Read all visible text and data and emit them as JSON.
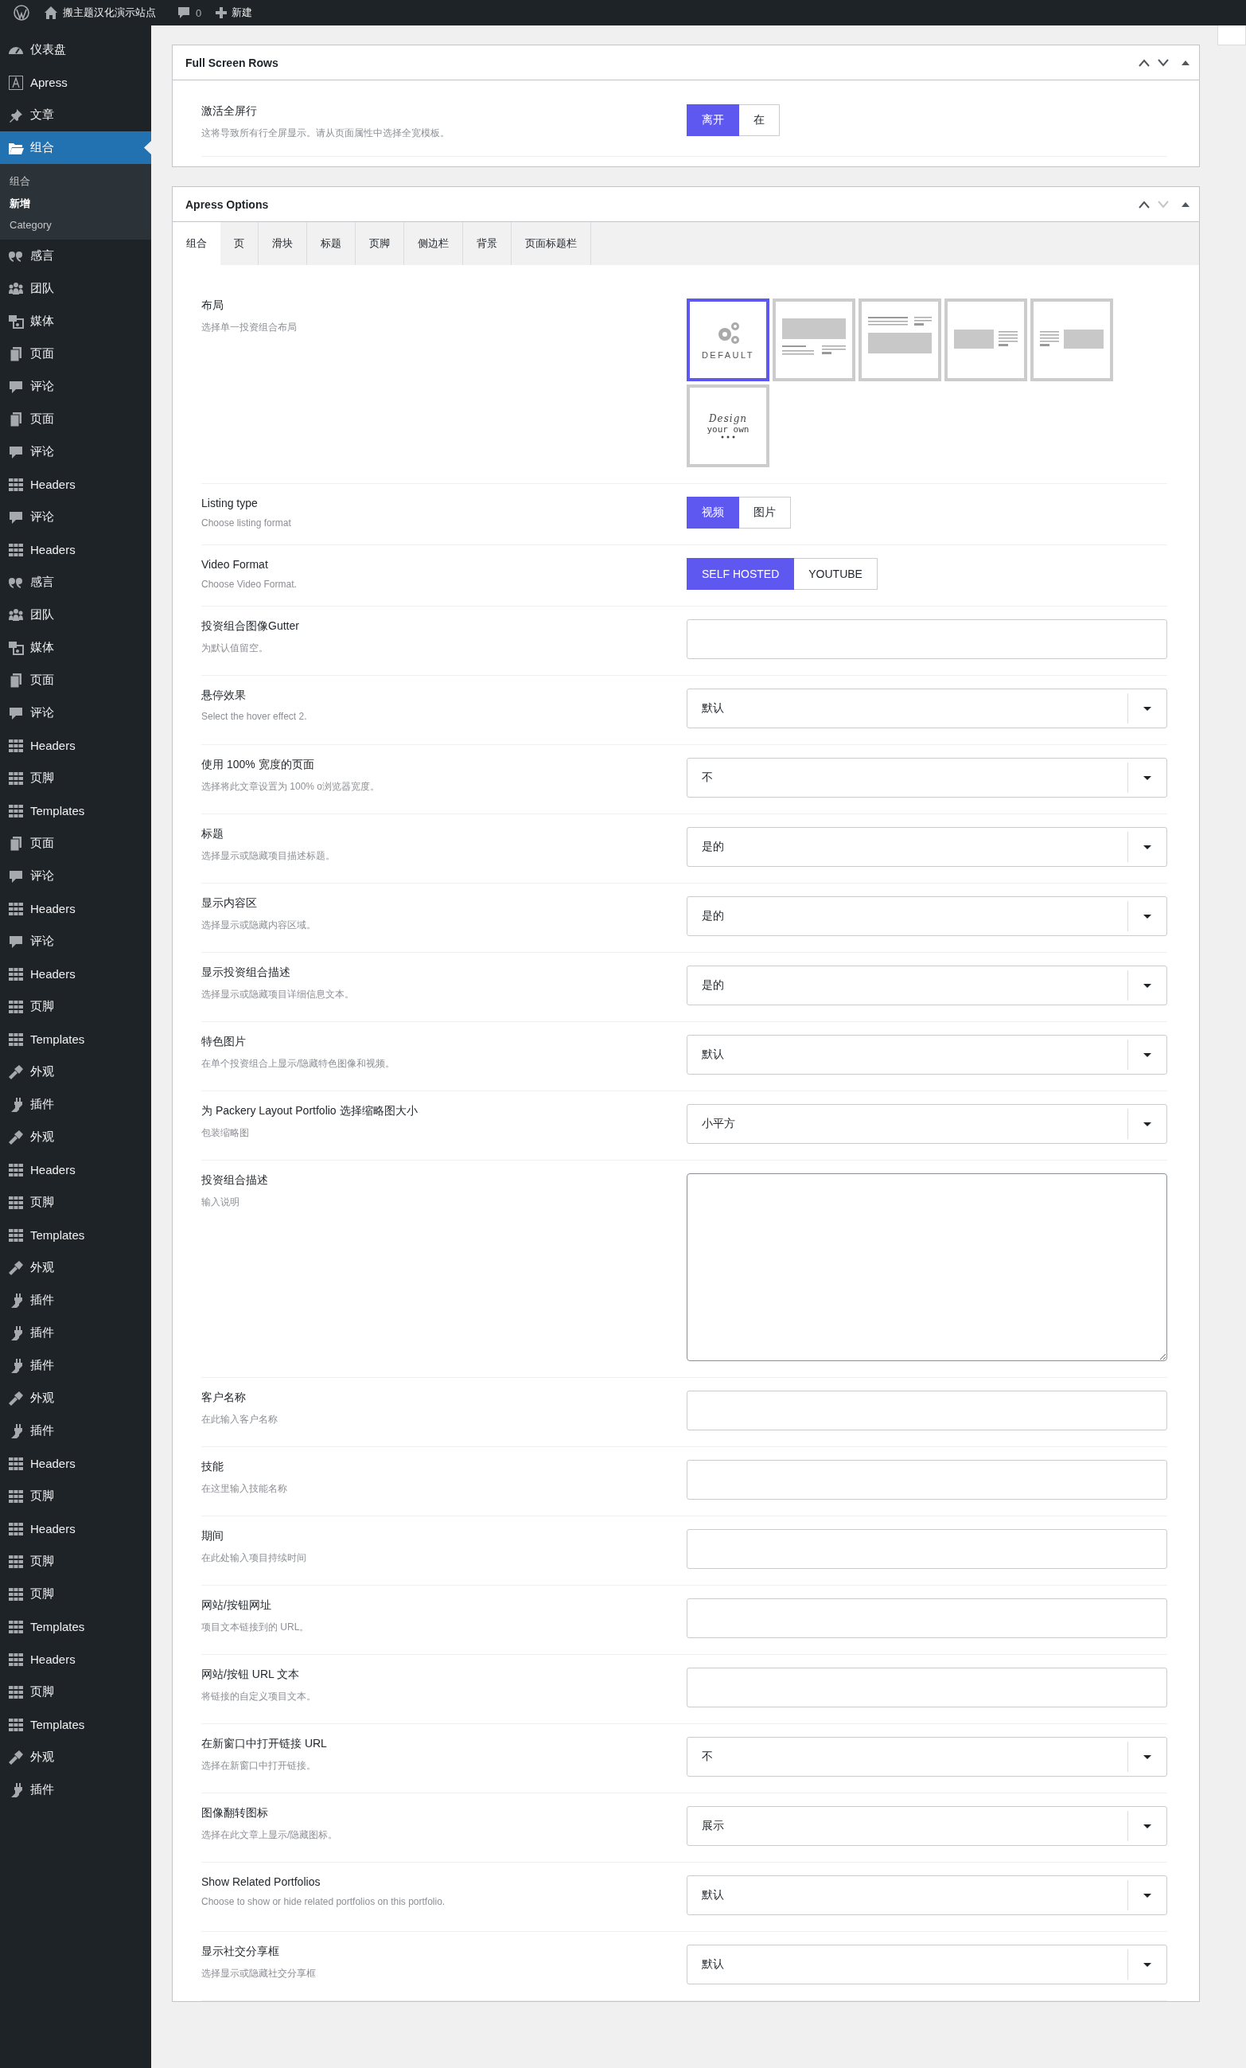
{
  "admin_bar": {
    "site_name": "搬主题汉化演示站点",
    "comments": "0",
    "new": "新建"
  },
  "sidebar": {
    "items": [
      {
        "label": "仪表盘",
        "kind": "dashboard",
        "selected": false
      },
      {
        "label": "Apress",
        "kind": "logo",
        "selected": false
      },
      {
        "label": "文章",
        "kind": "pin",
        "selected": false
      },
      {
        "label": "组合",
        "kind": "folder",
        "selected": true,
        "submenu": [
          {
            "label": "组合",
            "selected": false
          },
          {
            "label": "新增",
            "selected": true
          },
          {
            "label": "Category",
            "selected": false
          }
        ]
      },
      {
        "label": "感言",
        "kind": "quote",
        "selected": false
      },
      {
        "label": "团队",
        "kind": "team",
        "selected": false
      },
      {
        "label": "媒体",
        "kind": "media",
        "selected": false
      },
      {
        "label": "页面",
        "kind": "page",
        "selected": false
      },
      {
        "label": "评论",
        "kind": "comment",
        "selected": false
      },
      {
        "label": "页面",
        "kind": "page",
        "selected": false
      },
      {
        "label": "评论",
        "kind": "comment",
        "selected": false
      },
      {
        "label": "Headers",
        "kind": "table",
        "selected": false
      },
      {
        "label": "评论",
        "kind": "comment",
        "selected": false
      },
      {
        "label": "Headers",
        "kind": "table",
        "selected": false
      },
      {
        "label": "感言",
        "kind": "quote",
        "selected": false
      },
      {
        "label": "团队",
        "kind": "team",
        "selected": false
      },
      {
        "label": "媒体",
        "kind": "media",
        "selected": false
      },
      {
        "label": "页面",
        "kind": "page",
        "selected": false
      },
      {
        "label": "评论",
        "kind": "comment",
        "selected": false
      },
      {
        "label": "Headers",
        "kind": "table",
        "selected": false
      },
      {
        "label": "页脚",
        "kind": "table",
        "selected": false
      },
      {
        "label": "Templates",
        "kind": "table",
        "selected": false
      },
      {
        "label": "页面",
        "kind": "page",
        "selected": false
      },
      {
        "label": "评论",
        "kind": "comment",
        "selected": false
      },
      {
        "label": "Headers",
        "kind": "table",
        "selected": false
      },
      {
        "label": "评论",
        "kind": "comment",
        "selected": false
      },
      {
        "label": "Headers",
        "kind": "table",
        "selected": false
      },
      {
        "label": "页脚",
        "kind": "table",
        "selected": false
      },
      {
        "label": "Templates",
        "kind": "table",
        "selected": false
      },
      {
        "label": "外观",
        "kind": "brush",
        "selected": false
      },
      {
        "label": "插件",
        "kind": "plugin",
        "selected": false
      },
      {
        "label": "外观",
        "kind": "brush",
        "selected": false
      },
      {
        "label": "Headers",
        "kind": "table",
        "selected": false
      },
      {
        "label": "页脚",
        "kind": "table",
        "selected": false
      },
      {
        "label": "Templates",
        "kind": "table",
        "selected": false
      },
      {
        "label": "外观",
        "kind": "brush",
        "selected": false
      },
      {
        "label": "插件",
        "kind": "plugin",
        "selected": false
      },
      {
        "label": "插件",
        "kind": "plugin",
        "selected": false
      },
      {
        "label": "插件",
        "kind": "plugin",
        "selected": false
      },
      {
        "label": "外观",
        "kind": "brush",
        "selected": false
      },
      {
        "label": "插件",
        "kind": "plugin",
        "selected": false
      },
      {
        "label": "Headers",
        "kind": "table",
        "selected": false
      },
      {
        "label": "页脚",
        "kind": "table",
        "selected": false
      },
      {
        "label": "Headers",
        "kind": "table",
        "selected": false
      },
      {
        "label": "页脚",
        "kind": "table",
        "selected": false
      },
      {
        "label": "页脚",
        "kind": "table",
        "selected": false
      },
      {
        "label": "Templates",
        "kind": "table",
        "selected": false
      },
      {
        "label": "Headers",
        "kind": "table",
        "selected": false
      },
      {
        "label": "页脚",
        "kind": "table",
        "selected": false
      },
      {
        "label": "Templates",
        "kind": "table",
        "selected": false
      },
      {
        "label": "外观",
        "kind": "brush",
        "selected": false
      },
      {
        "label": "插件",
        "kind": "plugin",
        "selected": false
      }
    ]
  },
  "panels": [
    {
      "title": "Full Screen Rows",
      "can_move_down": true,
      "rows": [
        {
          "kind": "buttonset",
          "label": "激活全屏行",
          "description": "这将导致所有行全屏显示。请从页面属性中选择全宽模板。",
          "options": [
            {
              "label": "离开",
              "selected": true
            },
            {
              "label": "在",
              "selected": false
            }
          ]
        }
      ]
    },
    {
      "title": "Apress Options",
      "can_move_down": false,
      "tabs": [
        {
          "label": "组合",
          "selected": true
        },
        {
          "label": "页",
          "selected": false
        },
        {
          "label": "滑块",
          "selected": false
        },
        {
          "label": "标题",
          "selected": false
        },
        {
          "label": "页脚",
          "selected": false
        },
        {
          "label": "侧边栏",
          "selected": false
        },
        {
          "label": "背景",
          "selected": false
        },
        {
          "label": "页面标题栏",
          "selected": false
        }
      ],
      "rows": [
        {
          "kind": "image_select",
          "label": "布局",
          "description": "选择单一投资组合布局",
          "options": [
            {
              "kind": "gear",
              "label": "DEFAULT",
              "selected": true
            },
            {
              "kind": "image-top",
              "selected": false
            },
            {
              "kind": "text-top",
              "selected": false
            },
            {
              "kind": "image-left",
              "selected": false
            },
            {
              "kind": "image-right",
              "selected": false
            },
            {
              "kind": "design",
              "label": "Design",
              "sublabel": "your own",
              "selected": false
            }
          ]
        },
        {
          "kind": "buttonset",
          "label": "Listing type",
          "description": "Choose listing format",
          "options": [
            {
              "label": "视频",
              "selected": true
            },
            {
              "label": "图片",
              "selected": false
            }
          ]
        },
        {
          "kind": "buttonset",
          "label": "Video Format",
          "description": "Choose Video Format.",
          "options": [
            {
              "label": "SELF HOSTED",
              "selected": true
            },
            {
              "label": "YOUTUBE",
              "selected": false
            }
          ]
        },
        {
          "kind": "text",
          "label": "投资组合图像Gutter",
          "description": "为默认值留空。"
        },
        {
          "kind": "select",
          "label": "悬停效果",
          "description": "Select the hover effect 2.",
          "value": "默认"
        },
        {
          "kind": "select",
          "label": "使用 100% 宽度的页面",
          "description": "选择将此文章设置为 100% o浏览器宽度。",
          "value": "不"
        },
        {
          "kind": "select",
          "label": "标题",
          "description": "选择显示或隐藏项目描述标题。",
          "value": "是的"
        },
        {
          "kind": "select",
          "label": "显示内容区",
          "description": "选择显示或隐藏内容区域。",
          "value": "是的"
        },
        {
          "kind": "select",
          "label": "显示投资组合描述",
          "description": "选择显示或隐藏项目详细信息文本。",
          "value": "是的"
        },
        {
          "kind": "select",
          "label": "特色图片",
          "description": "在单个投资组合上显示/隐藏特色图像和视频。",
          "value": "默认"
        },
        {
          "kind": "select",
          "label": "为 Packery Layout Portfolio 选择缩略图大小",
          "description": "包装缩略图",
          "value": "小平方"
        },
        {
          "kind": "textarea",
          "label": "投资组合描述",
          "description": "输入说明"
        },
        {
          "kind": "text",
          "label": "客户名称",
          "description": "在此输入客户名称"
        },
        {
          "kind": "text",
          "label": "技能",
          "description": "在这里输入技能名称"
        },
        {
          "kind": "text",
          "label": "期间",
          "description": "在此处输入项目持续时间"
        },
        {
          "kind": "text",
          "label": "网站/按钮网址",
          "description": "项目文本链接到的 URL。"
        },
        {
          "kind": "text",
          "label": "网站/按钮 URL 文本",
          "description": "将链接的自定义项目文本。"
        },
        {
          "kind": "select",
          "label": "在新窗口中打开链接 URL",
          "description": "选择在新窗口中打开链接。",
          "value": "不"
        },
        {
          "kind": "select",
          "label": "图像翻转图标",
          "description": "选择在此文章上显示/隐藏图标。",
          "value": "展示"
        },
        {
          "kind": "select",
          "label": "Show Related Portfolios",
          "description": "Choose to show or hide related portfolios on this portfolio.",
          "value": "默认"
        },
        {
          "kind": "select",
          "label": "显示社交分享框",
          "description": "选择显示或隐藏社交分享框",
          "value": "默认"
        }
      ]
    }
  ]
}
